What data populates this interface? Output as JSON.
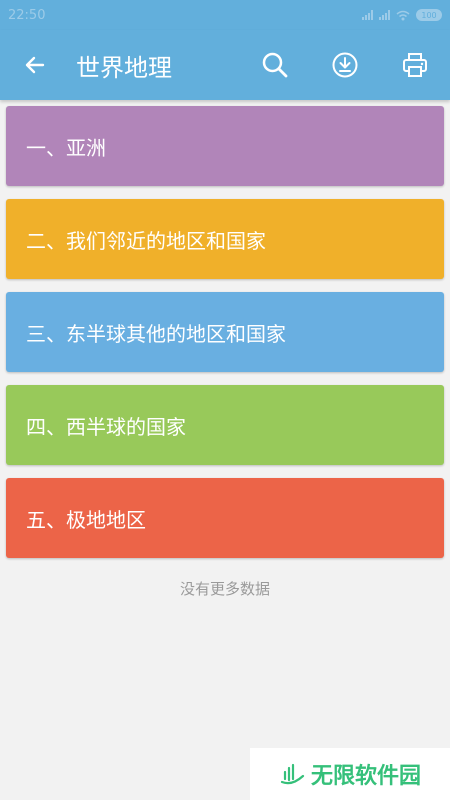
{
  "status_bar": {
    "time": "22:50",
    "battery": "100"
  },
  "app_bar": {
    "title": "世界地理"
  },
  "colors": {
    "primary": "#62afdc",
    "card_purple": "#b185b9",
    "card_yellow": "#f0b02a",
    "card_blue": "#69afe1",
    "card_green": "#98c95a",
    "card_red": "#ec6448"
  },
  "items": [
    {
      "label": "一、亚洲",
      "color": "#b185b9"
    },
    {
      "label": "二、我们邻近的地区和国家",
      "color": "#f0b02a"
    },
    {
      "label": "三、东半球其他的地区和国家",
      "color": "#69afe1"
    },
    {
      "label": "四、西半球的国家",
      "color": "#98c95a"
    },
    {
      "label": "五、极地地区",
      "color": "#ec6448"
    }
  ],
  "footer": {
    "no_more": "没有更多数据"
  },
  "watermark": {
    "text": "无限软件园"
  },
  "icons": {
    "back": "arrow-left-icon",
    "search": "search-icon",
    "download": "download-icon",
    "print": "printer-icon"
  }
}
